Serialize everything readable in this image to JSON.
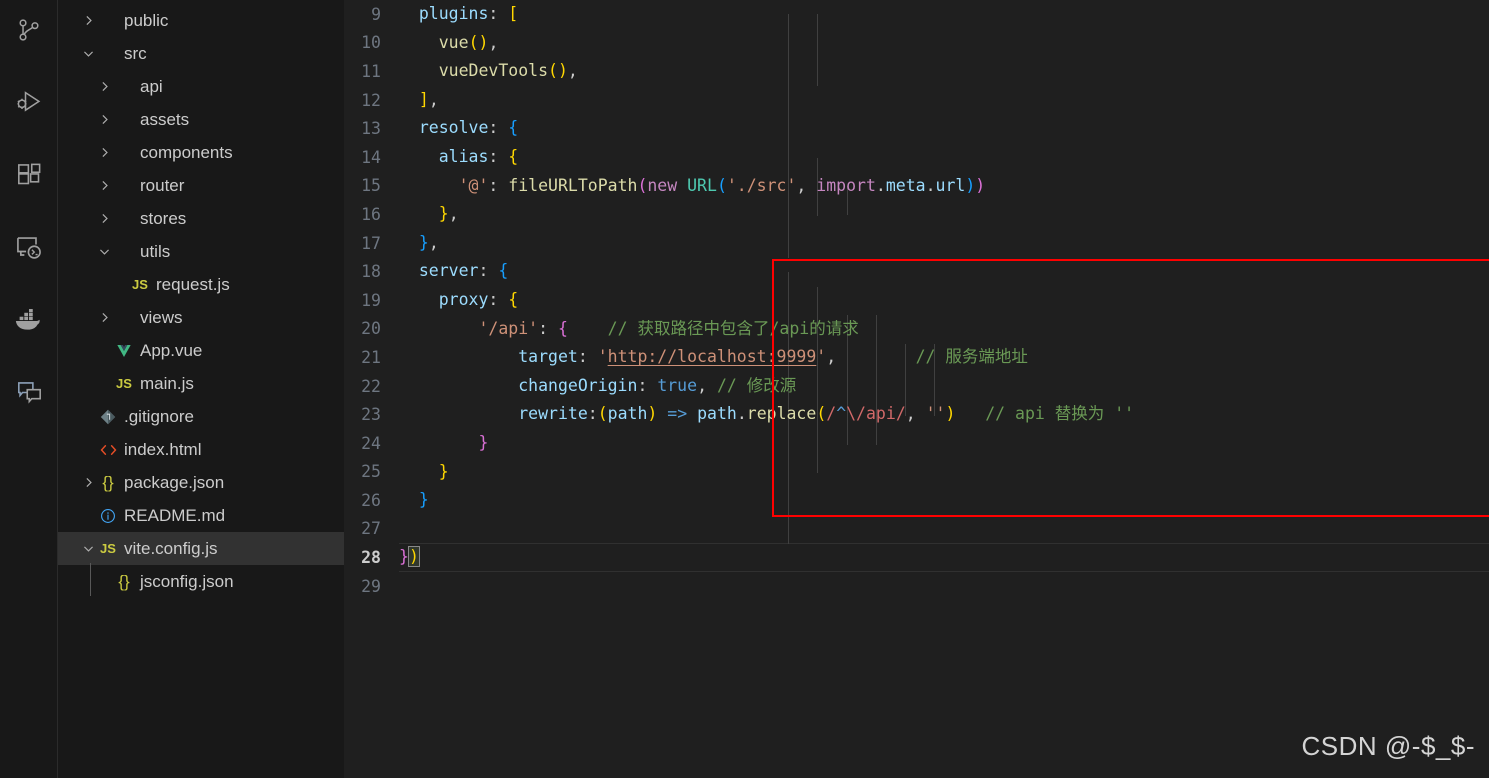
{
  "theme": {
    "editor_bg": "#1f1f1f",
    "sidebar_bg": "#181818",
    "activitybar_bg": "#181818",
    "selected_row_bg": "#323232",
    "annotation_color": "#ff0000",
    "line_number_color": "#6e7681"
  },
  "activity_bar": {
    "items": [
      {
        "name": "source-control-icon",
        "title": "Source Control"
      },
      {
        "name": "run-and-debug-icon",
        "title": "Run and Debug"
      },
      {
        "name": "extensions-icon",
        "title": "Extensions"
      },
      {
        "name": "remote-explorer-icon",
        "title": "Remote Explorer"
      },
      {
        "name": "docker-icon",
        "title": "Docker"
      },
      {
        "name": "chat-icon",
        "title": "Chat"
      }
    ]
  },
  "explorer": {
    "items": [
      {
        "label": "public",
        "indent": 1,
        "twisty": "chevron-right",
        "icon": "none",
        "selected": false
      },
      {
        "label": "src",
        "indent": 1,
        "twisty": "chevron-down",
        "icon": "none",
        "selected": false
      },
      {
        "label": "api",
        "indent": 2,
        "twisty": "chevron-right",
        "icon": "none",
        "selected": false
      },
      {
        "label": "assets",
        "indent": 2,
        "twisty": "chevron-right",
        "icon": "none",
        "selected": false
      },
      {
        "label": "components",
        "indent": 2,
        "twisty": "chevron-right",
        "icon": "none",
        "selected": false
      },
      {
        "label": "router",
        "indent": 2,
        "twisty": "chevron-right",
        "icon": "none",
        "selected": false
      },
      {
        "label": "stores",
        "indent": 2,
        "twisty": "chevron-right",
        "icon": "none",
        "selected": false
      },
      {
        "label": "utils",
        "indent": 2,
        "twisty": "chevron-down",
        "icon": "none",
        "selected": false
      },
      {
        "label": "request.js",
        "indent": 3,
        "twisty": "none",
        "icon": "js",
        "selected": false
      },
      {
        "label": "views",
        "indent": 2,
        "twisty": "chevron-right",
        "icon": "none",
        "selected": false
      },
      {
        "label": "App.vue",
        "indent": 2,
        "twisty": "none",
        "icon": "vue",
        "selected": false
      },
      {
        "label": "main.js",
        "indent": 2,
        "twisty": "none",
        "icon": "js",
        "selected": false
      },
      {
        "label": ".gitignore",
        "indent": 1,
        "twisty": "none",
        "icon": "git",
        "selected": false
      },
      {
        "label": "index.html",
        "indent": 1,
        "twisty": "none",
        "icon": "html",
        "selected": false
      },
      {
        "label": "package.json",
        "indent": 1,
        "twisty": "chevron-right",
        "icon": "json",
        "selected": false
      },
      {
        "label": "README.md",
        "indent": 1,
        "twisty": "none",
        "icon": "readme",
        "selected": false
      },
      {
        "label": "vite.config.js",
        "indent": 1,
        "twisty": "chevron-down",
        "icon": "js",
        "selected": true
      },
      {
        "label": "jsconfig.json",
        "indent": 2,
        "twisty": "none",
        "icon": "json",
        "selected": false
      }
    ]
  },
  "editor": {
    "active_line": 28,
    "first_visible_line": 9,
    "lines": [
      {
        "n": 9,
        "tokens": [
          {
            "t": "  ",
            "c": "plain"
          },
          {
            "t": "plugins",
            "c": "key"
          },
          {
            "t": ": ",
            "c": "plain"
          },
          {
            "t": "[",
            "c": "b1"
          }
        ]
      },
      {
        "n": 10,
        "tokens": [
          {
            "t": "    ",
            "c": "plain"
          },
          {
            "t": "vue",
            "c": "fn"
          },
          {
            "t": "(",
            "c": "b1"
          },
          {
            "t": ")",
            "c": "b1"
          },
          {
            "t": ",",
            "c": "plain"
          }
        ]
      },
      {
        "n": 11,
        "tokens": [
          {
            "t": "    ",
            "c": "plain"
          },
          {
            "t": "vueDevTools",
            "c": "fn"
          },
          {
            "t": "(",
            "c": "b1"
          },
          {
            "t": ")",
            "c": "b1"
          },
          {
            "t": ",",
            "c": "plain"
          }
        ]
      },
      {
        "n": 12,
        "tokens": [
          {
            "t": "  ",
            "c": "plain"
          },
          {
            "t": "]",
            "c": "b1"
          },
          {
            "t": ",",
            "c": "plain"
          }
        ]
      },
      {
        "n": 13,
        "tokens": [
          {
            "t": "  ",
            "c": "plain"
          },
          {
            "t": "resolve",
            "c": "key"
          },
          {
            "t": ": ",
            "c": "plain"
          },
          {
            "t": "{",
            "c": "b3"
          }
        ]
      },
      {
        "n": 14,
        "tokens": [
          {
            "t": "    ",
            "c": "plain"
          },
          {
            "t": "alias",
            "c": "key"
          },
          {
            "t": ": ",
            "c": "plain"
          },
          {
            "t": "{",
            "c": "b1"
          }
        ]
      },
      {
        "n": 15,
        "tokens": [
          {
            "t": "      ",
            "c": "plain"
          },
          {
            "t": "'@'",
            "c": "str"
          },
          {
            "t": ": ",
            "c": "plain"
          },
          {
            "t": "fileURLToPath",
            "c": "fn"
          },
          {
            "t": "(",
            "c": "b2"
          },
          {
            "t": "new",
            "c": "kw"
          },
          {
            "t": " ",
            "c": "plain"
          },
          {
            "t": "URL",
            "c": "cls"
          },
          {
            "t": "(",
            "c": "b3"
          },
          {
            "t": "'./src'",
            "c": "str"
          },
          {
            "t": ", ",
            "c": "plain"
          },
          {
            "t": "import",
            "c": "kw"
          },
          {
            "t": ".",
            "c": "plain"
          },
          {
            "t": "meta",
            "c": "var"
          },
          {
            "t": ".",
            "c": "plain"
          },
          {
            "t": "url",
            "c": "var"
          },
          {
            "t": ")",
            "c": "b3"
          },
          {
            "t": ")",
            "c": "b2"
          }
        ]
      },
      {
        "n": 16,
        "tokens": [
          {
            "t": "    ",
            "c": "plain"
          },
          {
            "t": "}",
            "c": "b1"
          },
          {
            "t": ",",
            "c": "plain"
          }
        ]
      },
      {
        "n": 17,
        "tokens": [
          {
            "t": "  ",
            "c": "plain"
          },
          {
            "t": "}",
            "c": "b3"
          },
          {
            "t": ",",
            "c": "plain"
          }
        ]
      },
      {
        "n": 18,
        "tokens": [
          {
            "t": "  ",
            "c": "plain"
          },
          {
            "t": "server",
            "c": "key"
          },
          {
            "t": ": ",
            "c": "plain"
          },
          {
            "t": "{",
            "c": "b3"
          }
        ]
      },
      {
        "n": 19,
        "tokens": [
          {
            "t": "    ",
            "c": "plain"
          },
          {
            "t": "proxy",
            "c": "key"
          },
          {
            "t": ": ",
            "c": "plain"
          },
          {
            "t": "{",
            "c": "b1"
          }
        ]
      },
      {
        "n": 20,
        "tokens": [
          {
            "t": "        ",
            "c": "plain"
          },
          {
            "t": "'/api'",
            "c": "str"
          },
          {
            "t": ": ",
            "c": "plain"
          },
          {
            "t": "{",
            "c": "b2"
          },
          {
            "t": "    ",
            "c": "plain"
          },
          {
            "t": "// 获取路径中包含了/api的请求",
            "c": "cmt"
          }
        ]
      },
      {
        "n": 21,
        "tokens": [
          {
            "t": "            ",
            "c": "plain"
          },
          {
            "t": "target",
            "c": "key"
          },
          {
            "t": ": ",
            "c": "plain"
          },
          {
            "t": "'",
            "c": "str"
          },
          {
            "t": "http://localhost:9999",
            "c": "link"
          },
          {
            "t": "'",
            "c": "str"
          },
          {
            "t": ",",
            "c": "plain"
          },
          {
            "t": "        ",
            "c": "plain"
          },
          {
            "t": "// 服务端地址",
            "c": "cmt"
          }
        ]
      },
      {
        "n": 22,
        "tokens": [
          {
            "t": "            ",
            "c": "plain"
          },
          {
            "t": "changeOrigin",
            "c": "key"
          },
          {
            "t": ": ",
            "c": "plain"
          },
          {
            "t": "true",
            "c": "ctl"
          },
          {
            "t": ", ",
            "c": "plain"
          },
          {
            "t": "// 修改源",
            "c": "cmt"
          }
        ]
      },
      {
        "n": 23,
        "tokens": [
          {
            "t": "            ",
            "c": "plain"
          },
          {
            "t": "rewrite",
            "c": "key"
          },
          {
            "t": ":",
            "c": "plain"
          },
          {
            "t": "(",
            "c": "b1"
          },
          {
            "t": "path",
            "c": "var"
          },
          {
            "t": ")",
            "c": "b1"
          },
          {
            "t": " ",
            "c": "plain"
          },
          {
            "t": "=>",
            "c": "ctl"
          },
          {
            "t": " ",
            "c": "plain"
          },
          {
            "t": "path",
            "c": "var"
          },
          {
            "t": ".",
            "c": "plain"
          },
          {
            "t": "replace",
            "c": "fn"
          },
          {
            "t": "(",
            "c": "b1"
          },
          {
            "t": "/",
            "c": "regex"
          },
          {
            "t": "^",
            "c": "ctl"
          },
          {
            "t": "\\/",
            "c": "regex"
          },
          {
            "t": "api",
            "c": "regex"
          },
          {
            "t": "/",
            "c": "regex"
          },
          {
            "t": ", ",
            "c": "plain"
          },
          {
            "t": "''",
            "c": "str"
          },
          {
            "t": ")",
            "c": "b1"
          },
          {
            "t": "   ",
            "c": "plain"
          },
          {
            "t": "// api 替换为 ''",
            "c": "cmt"
          }
        ]
      },
      {
        "n": 24,
        "tokens": [
          {
            "t": "        ",
            "c": "plain"
          },
          {
            "t": "}",
            "c": "b2"
          }
        ]
      },
      {
        "n": 25,
        "tokens": [
          {
            "t": "    ",
            "c": "plain"
          },
          {
            "t": "}",
            "c": "b1"
          }
        ]
      },
      {
        "n": 26,
        "tokens": [
          {
            "t": "  ",
            "c": "plain"
          },
          {
            "t": "}",
            "c": "b3"
          }
        ]
      },
      {
        "n": 27,
        "tokens": []
      },
      {
        "n": 28,
        "tokens": [
          {
            "t": "}",
            "c": "b2"
          },
          {
            "t": ")",
            "c": "b1",
            "match": true
          }
        ]
      },
      {
        "n": 29,
        "tokens": []
      }
    ],
    "annotation": {
      "shape": "rectangle",
      "color": "#ff0000",
      "covers_lines": "18-26"
    }
  },
  "watermark": {
    "text": "CSDN @-$_$-"
  }
}
